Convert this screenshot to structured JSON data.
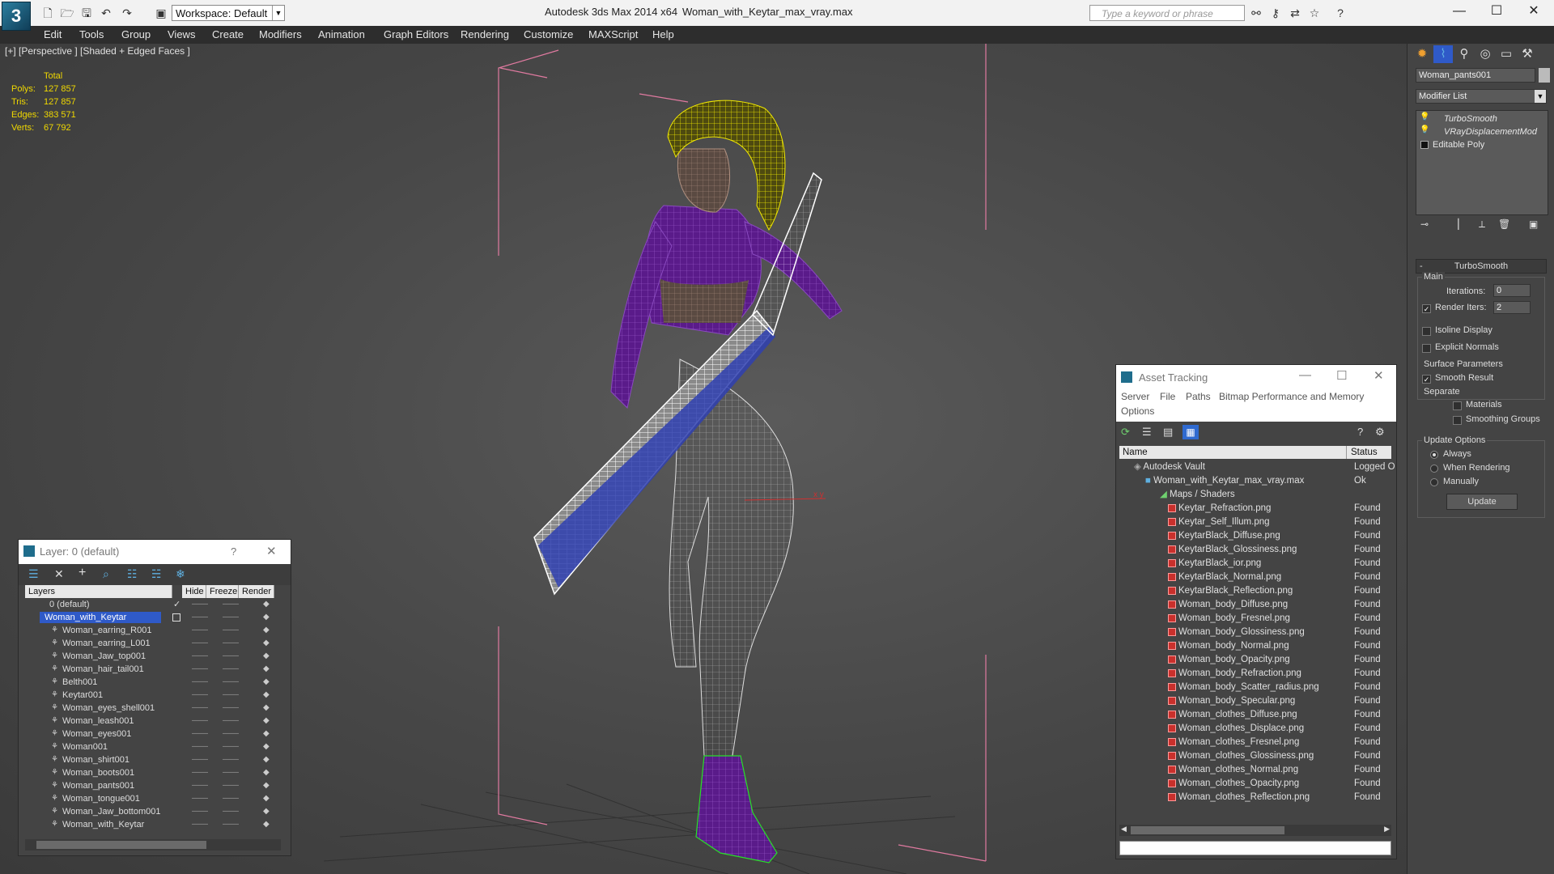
{
  "titlebar": {
    "app_title": "Autodesk 3ds Max  2014 x64",
    "file_title": "Woman_with_Keytar_max_vray.max",
    "workspace": "Workspace: Default",
    "search_placeholder": "Type a keyword or phrase"
  },
  "menu": [
    "Edit",
    "Tools",
    "Group",
    "Views",
    "Create",
    "Modifiers",
    "Animation",
    "Graph Editors",
    "Rendering",
    "Customize",
    "MAXScript",
    "Help"
  ],
  "viewport": {
    "label": "[+] [Perspective ] [Shaded + Edged Faces ]",
    "stats_header": "Total",
    "stats": [
      {
        "label": "Polys:",
        "value": "127 857"
      },
      {
        "label": "Tris:",
        "value": "127 857"
      },
      {
        "label": "Edges:",
        "value": "383 571"
      },
      {
        "label": "Verts:",
        "value": "67 792"
      }
    ]
  },
  "layer_dialog": {
    "title": "Layer: 0 (default)",
    "help": "?",
    "columns": [
      "Layers",
      "Hide",
      "Freeze",
      "Render"
    ],
    "rows": [
      {
        "name": "0 (default)"
      },
      {
        "name": "Woman_with_Keytar"
      },
      {
        "name": "Woman_earring_R001"
      },
      {
        "name": "Woman_earring_L001"
      },
      {
        "name": "Woman_Jaw_top001"
      },
      {
        "name": "Woman_hair_tail001"
      },
      {
        "name": "Belth001"
      },
      {
        "name": "Keytar001"
      },
      {
        "name": "Woman_eyes_shell001"
      },
      {
        "name": "Woman_leash001"
      },
      {
        "name": "Woman_eyes001"
      },
      {
        "name": "Woman001"
      },
      {
        "name": "Woman_shirt001"
      },
      {
        "name": "Woman_boots001"
      },
      {
        "name": "Woman_pants001"
      },
      {
        "name": "Woman_tongue001"
      },
      {
        "name": "Woman_Jaw_bottom001"
      },
      {
        "name": "Woman_with_Keytar"
      }
    ],
    "dash": "—— "
  },
  "asset_tracking": {
    "title": "Asset Tracking",
    "menu": [
      "Server",
      "File",
      "Paths",
      "Bitmap Performance and Memory",
      "Options"
    ],
    "columns": [
      "Name",
      "Status"
    ],
    "vault": {
      "name": "Autodesk Vault",
      "status": "Logged O"
    },
    "max_file": {
      "name": "Woman_with_Keytar_max_vray.max",
      "status": "Ok"
    },
    "maps_folder": "Maps / Shaders",
    "files": [
      {
        "name": "Keytar_Refraction.png",
        "status": "Found"
      },
      {
        "name": "Keytar_Self_Illum.png",
        "status": "Found"
      },
      {
        "name": "KeytarBlack_Diffuse.png",
        "status": "Found"
      },
      {
        "name": "KeytarBlack_Glossiness.png",
        "status": "Found"
      },
      {
        "name": "KeytarBlack_ior.png",
        "status": "Found"
      },
      {
        "name": "KeytarBlack_Normal.png",
        "status": "Found"
      },
      {
        "name": "KeytarBlack_Reflection.png",
        "status": "Found"
      },
      {
        "name": "Woman_body_Diffuse.png",
        "status": "Found"
      },
      {
        "name": "Woman_body_Fresnel.png",
        "status": "Found"
      },
      {
        "name": "Woman_body_Glossiness.png",
        "status": "Found"
      },
      {
        "name": "Woman_body_Normal.png",
        "status": "Found"
      },
      {
        "name": "Woman_body_Opacity.png",
        "status": "Found"
      },
      {
        "name": "Woman_body_Refraction.png",
        "status": "Found"
      },
      {
        "name": "Woman_body_Scatter_radius.png",
        "status": "Found"
      },
      {
        "name": "Woman_body_Specular.png",
        "status": "Found"
      },
      {
        "name": "Woman_clothes_Diffuse.png",
        "status": "Found"
      },
      {
        "name": "Woman_clothes_Displace.png",
        "status": "Found"
      },
      {
        "name": "Woman_clothes_Fresnel.png",
        "status": "Found"
      },
      {
        "name": "Woman_clothes_Glossiness.png",
        "status": "Found"
      },
      {
        "name": "Woman_clothes_Normal.png",
        "status": "Found"
      },
      {
        "name": "Woman_clothes_Opacity.png",
        "status": "Found"
      },
      {
        "name": "Woman_clothes_Reflection.png",
        "status": "Found"
      }
    ]
  },
  "command_panel": {
    "object_name": "Woman_pants001",
    "modifier_list": "Modifier List",
    "stack": [
      "TurboSmooth",
      "VRayDisplacementMod",
      "Editable Poly"
    ],
    "rollout_title": "TurboSmooth",
    "main_label": "Main",
    "iterations_label": "Iterations:",
    "iterations_value": "0",
    "render_iters_label": "Render Iters:",
    "render_iters_value": "2",
    "isoline_label": "Isoline Display",
    "explicit_normals_label": "Explicit Normals",
    "surface_label": "Surface Parameters",
    "smooth_result_label": "Smooth Result",
    "separate_label": "Separate",
    "materials_label": "Materials",
    "smoothing_groups_label": "Smoothing Groups",
    "update_options_label": "Update Options",
    "always_label": "Always",
    "when_rendering_label": "When Rendering",
    "manually_label": "Manually",
    "update_button": "Update"
  },
  "colors": {
    "viewport_bg": "#474747",
    "stats_text": "#f0d800",
    "selection": "#2f5ac8",
    "wire_purple": "#6a1fa0",
    "wire_yellow": "#e8e000",
    "wire_green": "#28e028",
    "bbox_pink": "#e07aa0"
  }
}
